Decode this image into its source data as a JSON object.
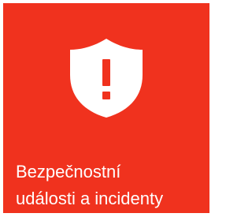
{
  "tile": {
    "label_line1": "Bezpečnostní",
    "label_line2": "události a incidenty",
    "icon": "shield-exclamation-icon",
    "background_color": "#F0321E",
    "foreground_color": "#FFFFFF"
  }
}
